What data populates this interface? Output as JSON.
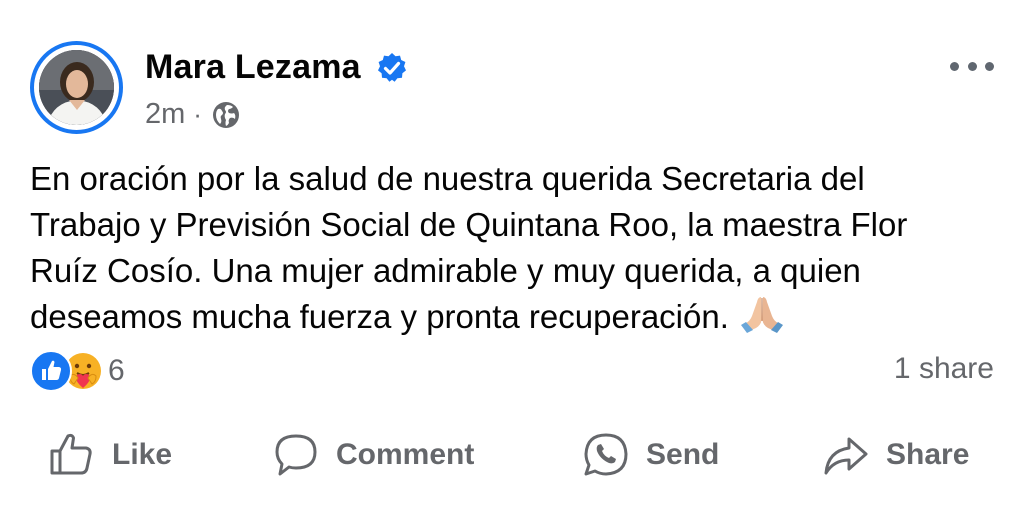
{
  "post": {
    "author": "Mara Lezama",
    "verified": true,
    "time": "2m",
    "separator": "·",
    "audience_icon": "globe-icon",
    "text_lines": [
      "En oración por la salud de nuestra querida Secretaria del",
      "Trabajo y Previsión Social de Quintana Roo, la maestra Flor",
      "Ruíz Cosío. Una mujer admirable y muy querida, a quien",
      "deseamos mucha fuerza y pronta recuperación."
    ],
    "emoji": "folded-hands-emoji"
  },
  "reactions": {
    "icons": [
      "like-reaction-icon",
      "care-reaction-icon"
    ],
    "count": "6",
    "shares": "1 share"
  },
  "actions": {
    "like": "Like",
    "comment": "Comment",
    "send": "Send",
    "share": "Share"
  },
  "colors": {
    "accent": "#1877f2",
    "secondary_text": "#65676b",
    "primary_text": "#050505"
  }
}
